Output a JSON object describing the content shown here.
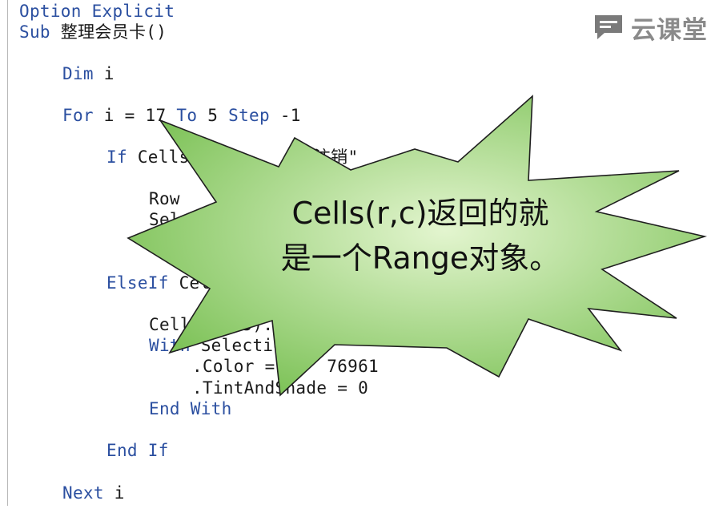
{
  "watermark": {
    "brand": "云课堂",
    "icon": "chat-bubble-icon"
  },
  "code": {
    "lines": [
      {
        "indent": 0,
        "parts": [
          [
            "kw",
            "Option Explicit"
          ]
        ]
      },
      {
        "indent": 0,
        "parts": [
          [
            "kw",
            "Sub "
          ],
          [
            "txt",
            "整理会员卡()"
          ]
        ]
      },
      {
        "indent": 1,
        "parts": [
          [
            "kw",
            "Dim"
          ],
          [
            "txt",
            " i"
          ]
        ]
      },
      {
        "indent": 1,
        "parts": [
          [
            "kw",
            "For"
          ],
          [
            "txt",
            " i = 17 "
          ],
          [
            "kw",
            "To"
          ],
          [
            "txt",
            " 5 "
          ],
          [
            "kw",
            "Step"
          ],
          [
            "txt",
            " -1"
          ]
        ]
      },
      {
        "indent": 2,
        "parts": [
          [
            "kw",
            "If"
          ],
          [
            "txt",
            " Cells(i,        \"注销\""
          ]
        ]
      },
      {
        "indent": 3,
        "parts": [
          [
            "txt",
            "Row"
          ]
        ]
      },
      {
        "indent": 3,
        "parts": [
          [
            "txt",
            "Selec"
          ]
        ]
      },
      {
        "indent": 2,
        "parts": [
          [
            "kw",
            "ElseIf"
          ],
          [
            "txt",
            " Cell"
          ]
        ]
      },
      {
        "indent": 3,
        "parts": [
          [
            "txt",
            "Cells(i, 5).Sel"
          ]
        ]
      },
      {
        "indent": 3,
        "parts": [
          [
            "kw",
            "With"
          ],
          [
            "txt",
            " Selection"
          ]
        ]
      },
      {
        "indent": 4,
        "parts": [
          [
            "txt",
            ".Color =     76961"
          ]
        ]
      },
      {
        "indent": 4,
        "parts": [
          [
            "txt",
            ".TintAndShade = 0"
          ]
        ]
      },
      {
        "indent": 3,
        "parts": [
          [
            "kw",
            "End With"
          ]
        ]
      },
      {
        "indent": 2,
        "parts": [
          [
            "kw",
            "End If"
          ]
        ]
      },
      {
        "indent": 1,
        "parts": [
          [
            "kw",
            "Next"
          ],
          [
            "txt",
            " i"
          ]
        ]
      }
    ]
  },
  "callout": {
    "line1": "Cells(r,c)返回的就",
    "line2": "是一个Range对象。",
    "fill_light": "#e3f5cf",
    "fill_dark": "#7fc35a",
    "stroke": "#1f1f1f"
  },
  "colors": {
    "keyword": "#2b4fa0",
    "text": "#1a1a1a",
    "background": "#ffffff"
  }
}
